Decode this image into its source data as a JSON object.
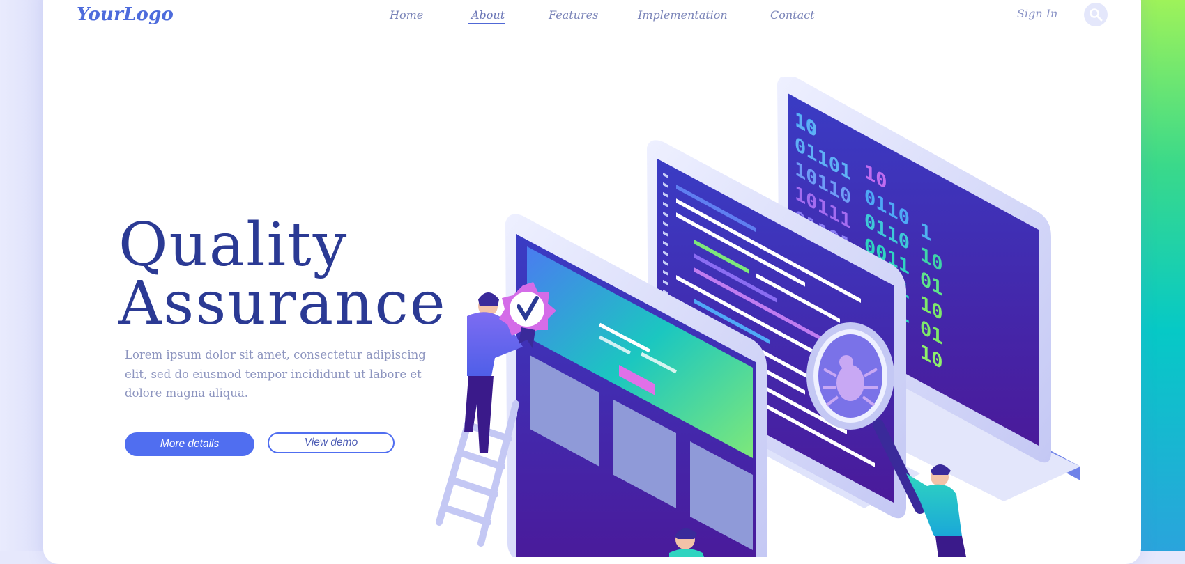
{
  "header": {
    "logo": "YourLogo",
    "nav": [
      {
        "label": "Home",
        "active": false
      },
      {
        "label": "About",
        "active": true
      },
      {
        "label": "Features",
        "active": false
      },
      {
        "label": "Implementation",
        "active": false
      },
      {
        "label": "Contact",
        "active": false
      }
    ],
    "sign_in": "Sign In",
    "search_icon": "search-icon"
  },
  "hero": {
    "title_line1": "Quality",
    "title_line2": "Assurance",
    "description": "Lorem ipsum dolor sit amet, consectetur adipiscing elit, sed do eiusmod tempor incididunt ut labore et dolore magna aliqua.",
    "primary_button": "More details",
    "secondary_button": "View demo"
  },
  "illustration": {
    "binary_rows": [
      "10",
      "01101 10",
      "10110 0110",
      "10111 0110",
      "01101 0011 10",
      "10110 0101 10",
      "01101 0011 0 01",
      "10110 0110 0 010"
    ],
    "icons": [
      "certificate-badge-icon",
      "magnifier-icon",
      "bug-icon",
      "ladder-icon"
    ]
  },
  "colors": {
    "brand": "#4d6bdc",
    "title": "#2b3a94",
    "primary_button": "#506ef0",
    "text_muted": "#8d95bf"
  }
}
